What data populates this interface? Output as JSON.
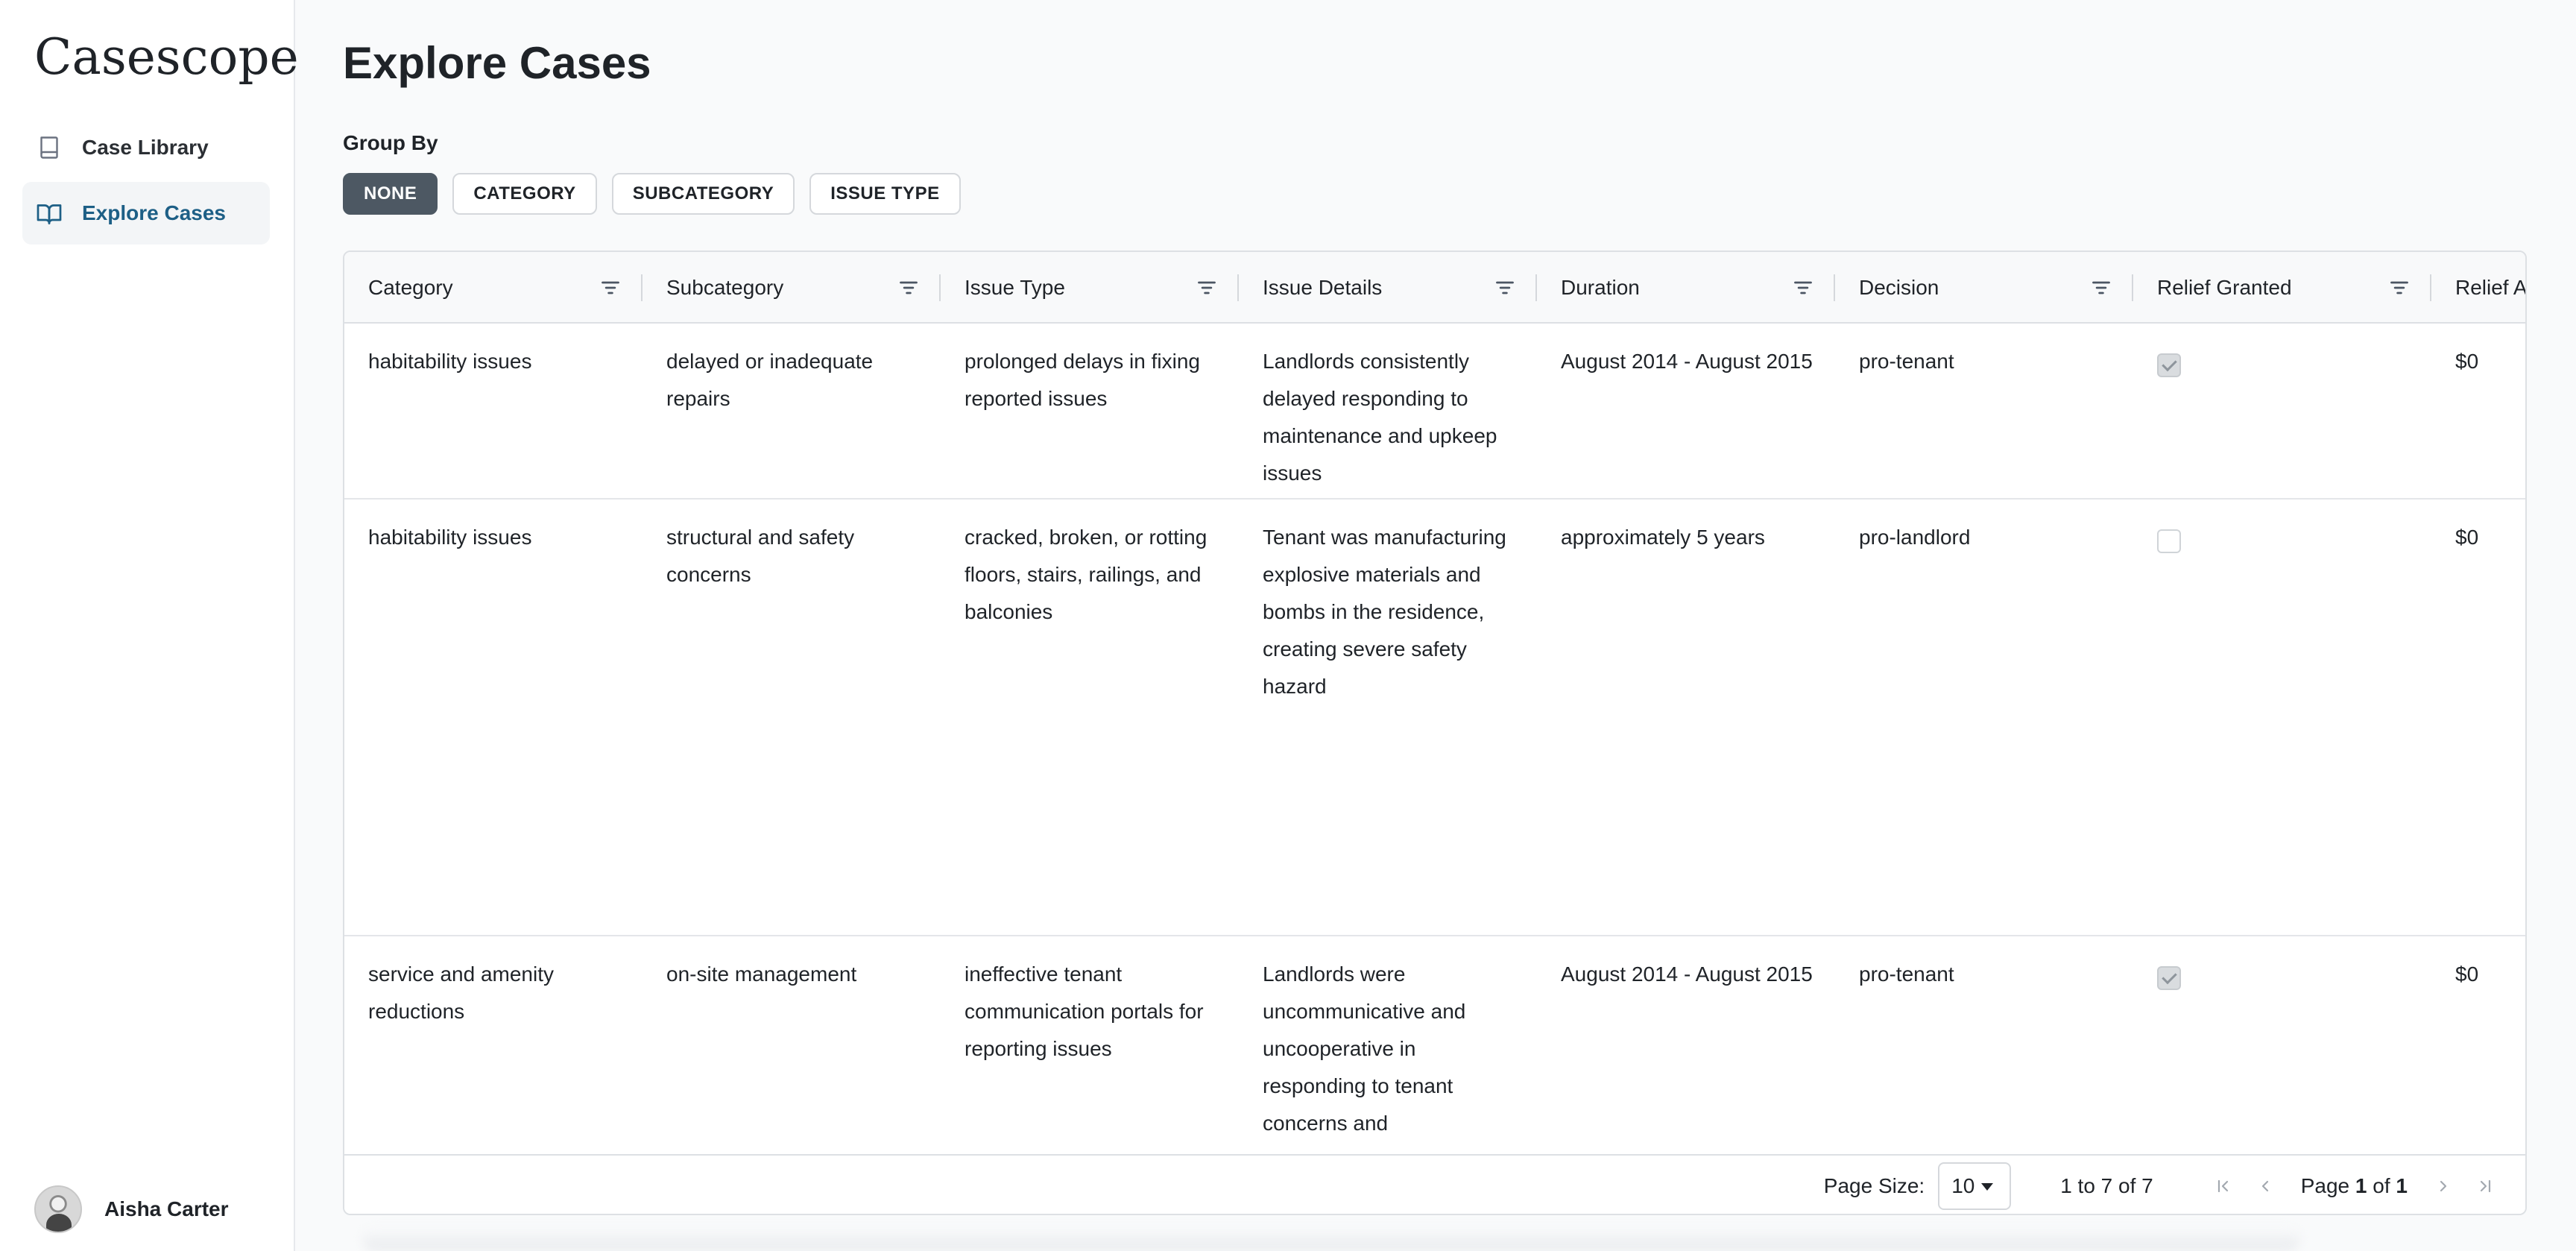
{
  "app": {
    "brand": "Casescope"
  },
  "sidebar": {
    "items": [
      {
        "label": "Case Library",
        "icon": "book-icon",
        "active": false
      },
      {
        "label": "Explore Cases",
        "icon": "open-book-icon",
        "active": true
      }
    ],
    "user": {
      "name": "Aisha Carter"
    }
  },
  "page": {
    "title": "Explore Cases"
  },
  "group_by": {
    "label": "Group By",
    "options": [
      "NONE",
      "CATEGORY",
      "SUBCATEGORY",
      "ISSUE TYPE"
    ],
    "selected": "NONE"
  },
  "table": {
    "columns": [
      "Category",
      "Subcategory",
      "Issue Type",
      "Issue Details",
      "Duration",
      "Decision",
      "Relief Granted",
      "Relief A"
    ],
    "rows": [
      {
        "category": "habitability issues",
        "subcategory": "delayed or inadequate repairs",
        "issue_type": "prolonged delays in fixing reported issues",
        "issue_details": "Landlords consistently delayed responding to maintenance and upkeep issues",
        "duration": "August 2014 - August 2015",
        "decision": "pro-tenant",
        "relief_granted": true,
        "relief_amount": "$0"
      },
      {
        "category": "habitability issues",
        "subcategory": "structural and safety concerns",
        "issue_type": "cracked, broken, or rotting floors, stairs, railings, and balconies",
        "issue_details": "Tenant was manufacturing explosive materials and bombs in the residence, creating severe safety hazard",
        "duration": "approximately 5 years",
        "decision": "pro-landlord",
        "relief_granted": false,
        "relief_amount": "$0"
      },
      {
        "category": "service and amenity reductions",
        "subcategory": "on-site management",
        "issue_type": "ineffective tenant communication portals for reporting issues",
        "issue_details": "Landlords were uncommunicative and uncooperative in responding to tenant concerns and",
        "duration": "August 2014 - August 2015",
        "decision": "pro-tenant",
        "relief_granted": true,
        "relief_amount": "$0"
      }
    ]
  },
  "pagination": {
    "page_size_label": "Page Size:",
    "page_size": "10",
    "range_text": "1 to 7 of 7",
    "page_word": "Page",
    "current_page": "1",
    "of_word": "of",
    "total_pages": "1"
  },
  "colors": {
    "accent": "#1d5f86",
    "active_button": "#4d5863",
    "border": "#dde0e4"
  }
}
